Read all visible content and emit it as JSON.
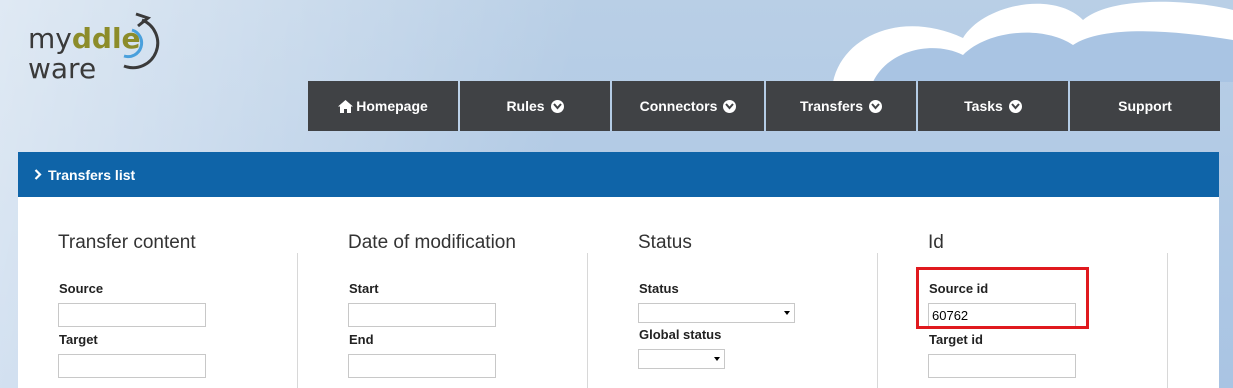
{
  "logo": {
    "line1_a": "my",
    "line1_b": "ddle",
    "line2": "ware"
  },
  "nav": {
    "items": [
      {
        "label": "Homepage",
        "icon": "home-icon",
        "dropdown": false
      },
      {
        "label": "Rules",
        "dropdown": true
      },
      {
        "label": "Connectors",
        "dropdown": true
      },
      {
        "label": "Transfers",
        "dropdown": true
      },
      {
        "label": "Tasks",
        "dropdown": true
      },
      {
        "label": "Support",
        "dropdown": false
      }
    ]
  },
  "panel": {
    "title": "Transfers list"
  },
  "filters": {
    "transfer_content": {
      "heading": "Transfer content",
      "source_label": "Source",
      "source_value": "",
      "target_label": "Target",
      "target_value": ""
    },
    "date": {
      "heading": "Date of modification",
      "start_label": "Start",
      "start_value": "",
      "end_label": "End",
      "end_value": ""
    },
    "status": {
      "heading": "Status",
      "status_label": "Status",
      "status_value": "",
      "global_label": "Global status",
      "global_value": ""
    },
    "id": {
      "heading": "Id",
      "source_id_label": "Source id",
      "source_id_value": "60762",
      "target_id_label": "Target id",
      "target_id_value": ""
    }
  },
  "colors": {
    "nav_bg": "#404245",
    "header_bg": "#0f64a8",
    "highlight": "#e0191e"
  }
}
